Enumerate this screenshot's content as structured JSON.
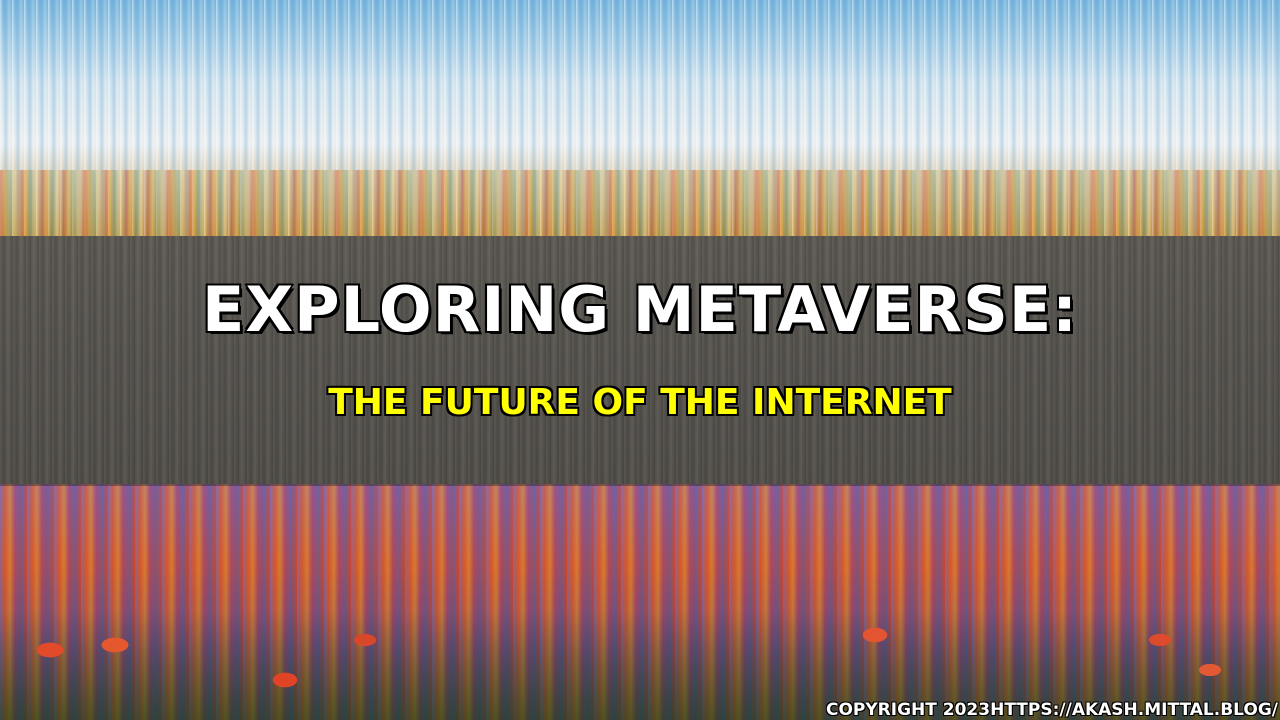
{
  "hero": {
    "title": "Exploring Metaverse:",
    "subtitle": "The Future of the Internet"
  },
  "footer": {
    "copyright": "Copyright 2023https://akash.mittal.blog/"
  },
  "colors": {
    "title_text": "#ffffff",
    "subtitle_text": "#ffff00",
    "band_overlay": "rgba(40,40,40,0.45)"
  }
}
